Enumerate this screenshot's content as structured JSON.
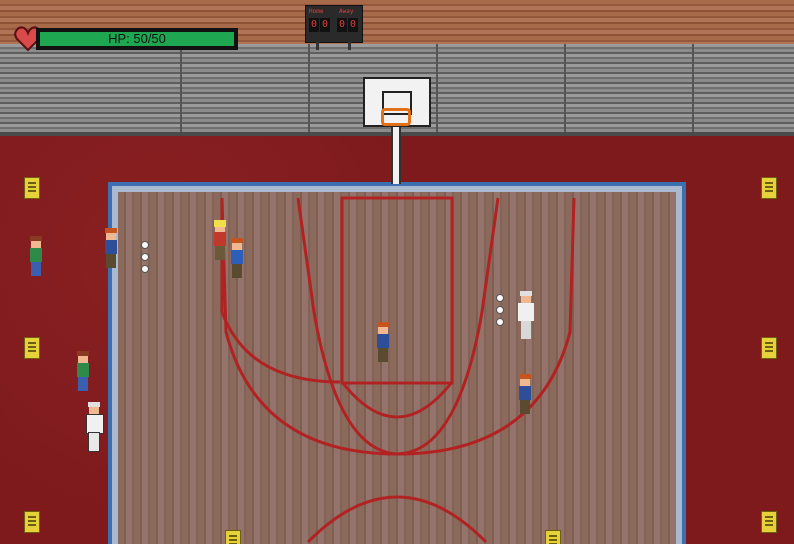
{
  "hud": {
    "hp_label": "HP: 50/50",
    "hp_current": 50,
    "hp_max": 50,
    "hp_fraction": 1.0,
    "heart_color": "#d94a4a",
    "bar_color": "#1fa650"
  },
  "scoreboard": {
    "home_label": "Home",
    "away_label": "Away",
    "home_digits": [
      "0",
      "0"
    ],
    "away_digits": [
      "0",
      "0"
    ]
  },
  "colors": {
    "apron": "#7e1a1c",
    "court_border": "#3b6fb0",
    "court_lines": "#b22222",
    "rim": "#e0701a"
  },
  "icons": {
    "heart": "heart-icon",
    "wet_floor_sign": "wet-floor-sign-icon",
    "dodgeball": "dodgeball-icon"
  }
}
